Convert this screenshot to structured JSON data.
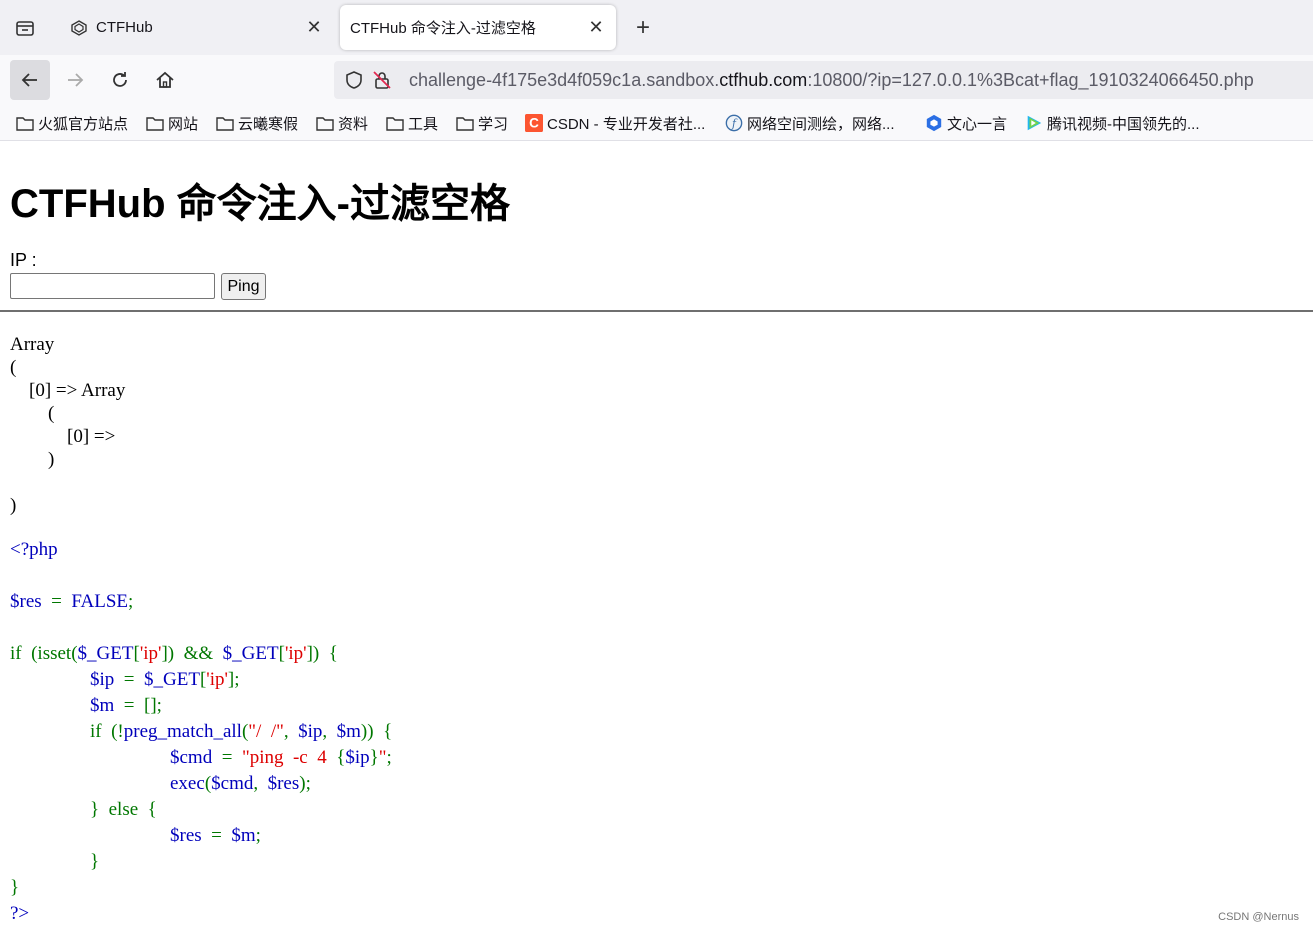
{
  "tabs": [
    {
      "title": "CTFHub"
    },
    {
      "title": "CTFHub 命令注入-过滤空格"
    }
  ],
  "url": {
    "prefix": "challenge-4f175e3d4f059c1a.sandbox.",
    "domain": "ctfhub.com",
    "suffix": ":10800/?ip=127.0.0.1%3Bcat+flag_1910324066450.php"
  },
  "bookmarks": [
    {
      "label": "火狐官方站点",
      "icon": "folder-icon"
    },
    {
      "label": "网站",
      "icon": "folder-icon"
    },
    {
      "label": "云曦寒假",
      "icon": "folder-icon"
    },
    {
      "label": "资料",
      "icon": "folder-icon"
    },
    {
      "label": "工具",
      "icon": "folder-icon"
    },
    {
      "label": "学习",
      "icon": "folder-icon"
    },
    {
      "label": "CSDN - 专业开发者社...",
      "icon": "csdn-icon"
    },
    {
      "label": "网络空间测绘，网络...",
      "icon": "fofa-icon"
    },
    {
      "label": "文心一言",
      "icon": "wenxin-icon"
    },
    {
      "label": "腾讯视频-中国领先的...",
      "icon": "tencent-video-icon"
    }
  ],
  "page": {
    "heading": "CTFHub 命令注入-过滤空格",
    "ip_label": "IP :",
    "ip_value": "",
    "ping_label": "Ping",
    "output_lines": [
      "Array",
      "(",
      "    [0] => Array",
      "        (",
      "            [0] =>",
      "        )",
      "",
      ")"
    ],
    "php_open": "<?php",
    "php_close": "?>"
  },
  "watermark": "CSDN @Nernus",
  "colors": {
    "php_keyword": "#007700",
    "php_default": "#0000bb",
    "php_string": "#dd0000"
  }
}
